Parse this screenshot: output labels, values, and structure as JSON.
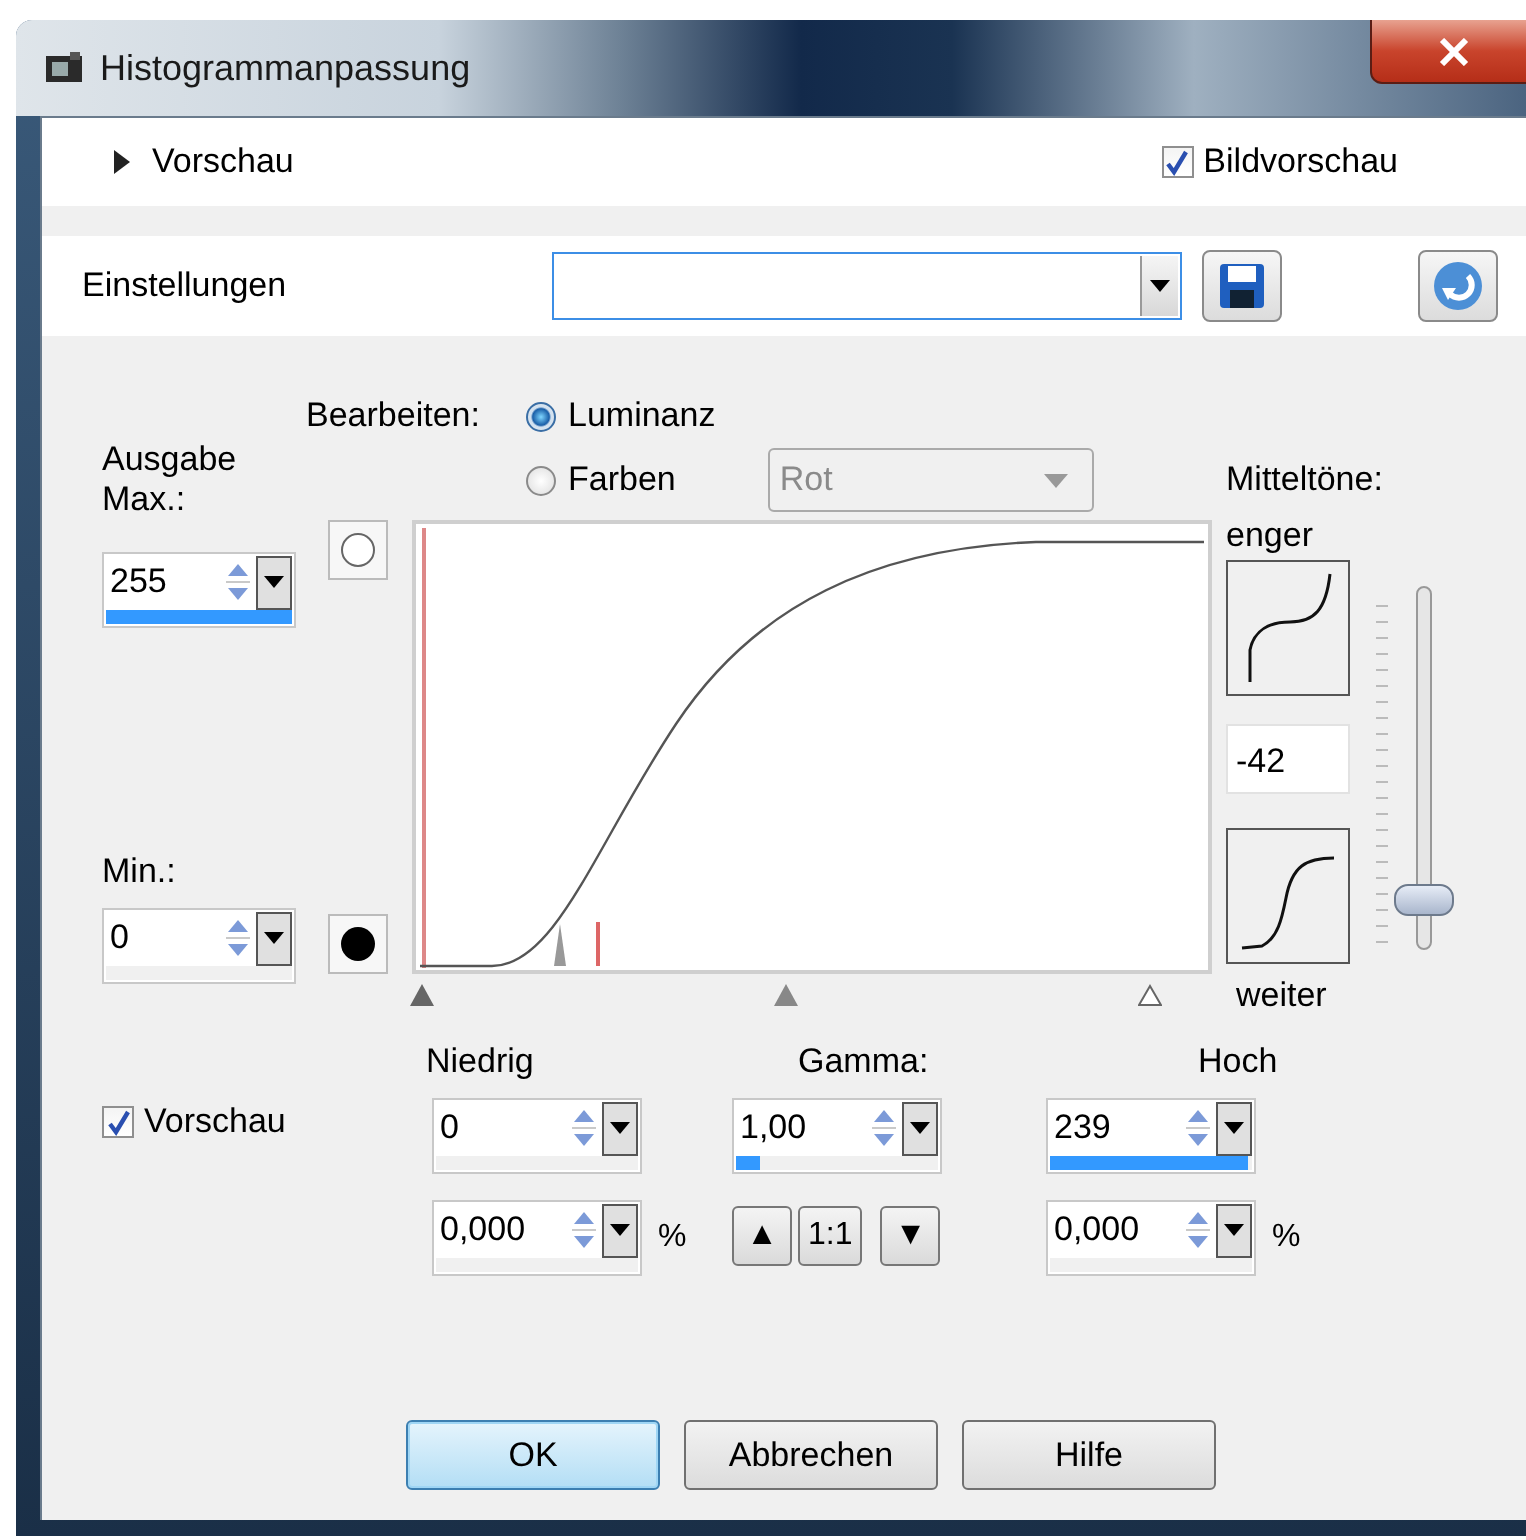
{
  "window": {
    "title": "Histogrammanpassung"
  },
  "preview_section": {
    "label": "Vorschau",
    "expanded": false
  },
  "image_preview": {
    "label": "Bildvorschau",
    "checked": true
  },
  "presets": {
    "label": "Einstellungen"
  },
  "edit": {
    "label": "Bearbeiten:",
    "modes": [
      {
        "label": "Luminanz",
        "selected": true
      },
      {
        "label": "Farben",
        "selected": false
      }
    ],
    "channel": {
      "value": "Rot",
      "disabled": true
    }
  },
  "output": {
    "label": "Ausgabe Max.:",
    "max": {
      "value": "255",
      "level": 1
    },
    "min_label": "Min.:",
    "min": {
      "value": "0"
    }
  },
  "midtones": {
    "label": "Mitteltöne:",
    "narrower_label": "enger",
    "value": "-42",
    "wider_label": "weiter",
    "level": 0.13
  },
  "preview": {
    "label": "Vorschau",
    "checked": true
  },
  "levels": [
    {
      "kind": "input",
      "label": "Niedrig",
      "value": "0",
      "percent": "0,000",
      "unit": "%"
    },
    {
      "kind": "gamma",
      "label": "Gamma:",
      "value": "1,00",
      "level": 0.12,
      "steps": [
        "▲",
        "1:1",
        "▼"
      ]
    },
    {
      "kind": "input",
      "label": "Hoch",
      "value": "239",
      "level": 0.98,
      "percent": "0,000",
      "unit": "%"
    }
  ],
  "buttons": [
    {
      "label": "OK",
      "default": true
    },
    {
      "label": "Abbrechen",
      "default": false
    },
    {
      "label": "Hilfe",
      "default": false
    }
  ]
}
